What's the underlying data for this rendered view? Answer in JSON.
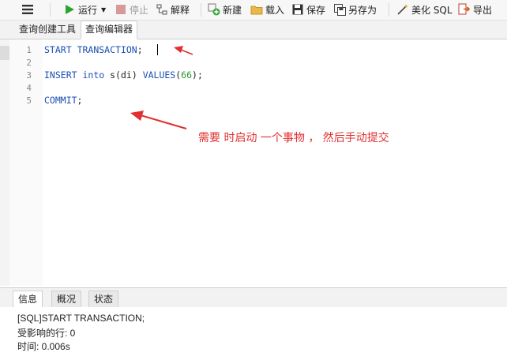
{
  "toolbar": {
    "run_label": "运行",
    "stop_label": "停止",
    "explain_label": "解释",
    "new_label": "新建",
    "load_label": "载入",
    "save_label": "保存",
    "saveas_label": "另存为",
    "beautify_label": "美化 SQL",
    "export_label": "导出"
  },
  "tabs": [
    {
      "label": "查询创建工具"
    },
    {
      "label": "查询编辑器"
    }
  ],
  "editor": {
    "line_numbers": [
      "1",
      "2",
      "3",
      "4",
      "5"
    ],
    "line1": {
      "kw1": "START",
      "kw2": "TRANSACTION",
      "semi": ";"
    },
    "line3": {
      "kw1": "INSERT",
      "kw2": "into",
      "plain1": "s(di)",
      "kw3": "VALUES",
      "paren_open": "(",
      "num": "66",
      "paren_close": ");"
    },
    "line5": {
      "kw1": "COMMIT",
      "semi": ";"
    }
  },
  "annotation": {
    "text": "需要  时启动  一个事物 ， 然后手动提交",
    "color": "#e03030"
  },
  "bottom_tabs": [
    {
      "label": "信息"
    },
    {
      "label": "概况"
    },
    {
      "label": "状态"
    }
  ],
  "info": {
    "line1": "[SQL]START TRANSACTION;",
    "line2": "受影响的行: 0",
    "line3": "时间: 0.006s"
  },
  "colors": {
    "keyword": "#1a4fb5",
    "number": "#2a9a2a",
    "run_icon": "#2aa52a",
    "annotation": "#e03030"
  }
}
